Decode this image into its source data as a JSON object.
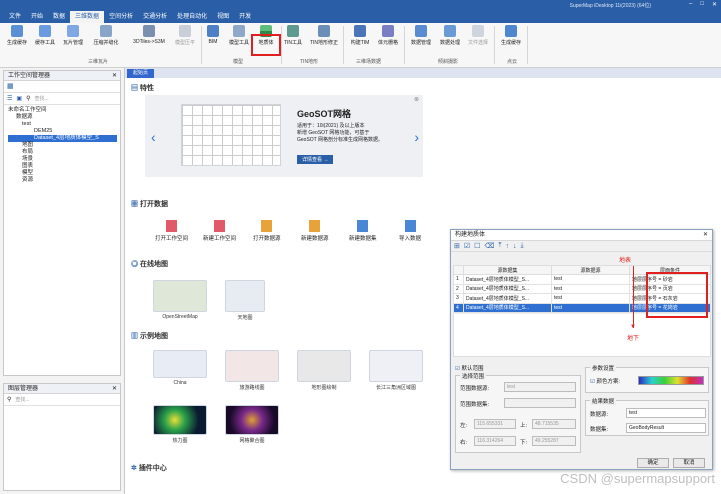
{
  "app_title": "SuperMap iDesktop 11i(2023) (64位)",
  "menus": [
    "文件",
    "开始",
    "数据",
    "三维数据",
    "空间分析",
    "交通分析",
    "处理自动化",
    "视图",
    "开发"
  ],
  "ribbon": {
    "buttons": [
      {
        "label": "生成缓存",
        "icon": "cache-icon"
      },
      {
        "label": "缓存工具",
        "icon": "cache-tool-icon"
      },
      {
        "label": "瓦片管理",
        "icon": "tile-manage-icon"
      },
      {
        "label": "压缩并缝化",
        "icon": "compress-icon"
      },
      {
        "label": "3DTiles->S3M",
        "icon": "convert-icon"
      },
      {
        "label": "模型压平",
        "icon": "flatten-icon"
      },
      {
        "label": "BIM",
        "icon": "bim-icon"
      },
      {
        "label": "模型工具",
        "icon": "model-tool-icon"
      },
      {
        "label": "地质体",
        "icon": "geobody-icon"
      },
      {
        "label": "TIN工具",
        "icon": "tin-tool-icon"
      },
      {
        "label": "TIN地形修正",
        "icon": "tin-fix-icon"
      },
      {
        "label": "构建TIM",
        "icon": "tim-icon"
      },
      {
        "label": "体元栅格",
        "icon": "voxel-icon"
      },
      {
        "label": "数据管理",
        "icon": "data-manage-icon"
      },
      {
        "label": "数据处理",
        "icon": "data-process-icon"
      },
      {
        "label": "文件选择",
        "icon": "file-select-icon"
      },
      {
        "label": "生成缓存",
        "icon": "pointcloud-cache-icon"
      }
    ],
    "groups": [
      "三维瓦片",
      "模型",
      "TIN地形",
      "三维场数据",
      "倾斜摄影",
      "点云"
    ]
  },
  "workspace": {
    "title": "工作空间管理器",
    "search_placeholder": "查找...",
    "tree": [
      "未命名工作空间",
      "数据源",
      "test",
      "DEM25",
      "Dataset_4层地质体模型_S",
      "地图",
      "布局",
      "场景",
      "图表",
      "模型",
      "资源"
    ]
  },
  "layers": {
    "title": "图层管理器",
    "search_placeholder": "查找..."
  },
  "doc": {
    "tab": "起始页",
    "sections": [
      "特性",
      "打开数据",
      "在线地图",
      "示例地图",
      "插件中心"
    ],
    "banner": {
      "title": "GeoSOT网格",
      "line1": "适用于：10i(2021) 及以上版本",
      "line2": "新增 GeoSOT 网格功能，可基于",
      "line3": "GeoSOT 网格剖分标准生成网格数据。",
      "button": "详情查看 →"
    },
    "quick": [
      "打开工作空间",
      "新建工作空间",
      "打开数据源",
      "新建数据源",
      "新建数据集",
      "导入数据"
    ],
    "online": [
      "OpenStreetMap",
      "天地图"
    ],
    "samples": [
      "China",
      "旅游路线图",
      "地形图绘制",
      "长江三角洲区域图",
      "热力图",
      "网格聚合图"
    ]
  },
  "dialog": {
    "title": "构建地质体",
    "table_headers": [
      "",
      "源数据集",
      "源数据源",
      "层面条件"
    ],
    "rows": [
      [
        "1",
        "Dataset_4层地质体模型_S...",
        "test",
        "地层层序号 = 砂岩"
      ],
      [
        "2",
        "Dataset_4层地质体模型_S...",
        "test",
        "地层层序号 = 页岩"
      ],
      [
        "3",
        "Dataset_4层地质体模型_S...",
        "test",
        "地层层序号 = 石灰岩"
      ],
      [
        "4",
        "Dataset_4层地质体模型_S...",
        "test",
        "地层层序号 = 花岗岩"
      ]
    ],
    "default_range": "默认范围",
    "select_range": "选择范围",
    "range_ds_label": "范围数据源:",
    "range_ds_value": "test",
    "range_set_label": "范围数据集:",
    "left_label": "左:",
    "left_value": "115.655331",
    "top_label": "上:",
    "top_value": "48.715535",
    "right_label": "右:",
    "right_value": "116.314264",
    "bottom_label": "下:",
    "bottom_value": "49.255287",
    "params_title": "参数设置",
    "color_scheme": "颜色方案:",
    "result_title": "结果数据",
    "result_ds_label": "数据源:",
    "result_ds_value": "test",
    "result_set_label": "数据集:",
    "result_set_value": "GeoBodyResult",
    "ok": "确定",
    "cancel": "取消"
  },
  "annotations": {
    "surface": "地表",
    "underground": "地下"
  },
  "watermark": "CSDN @supermapsupport"
}
